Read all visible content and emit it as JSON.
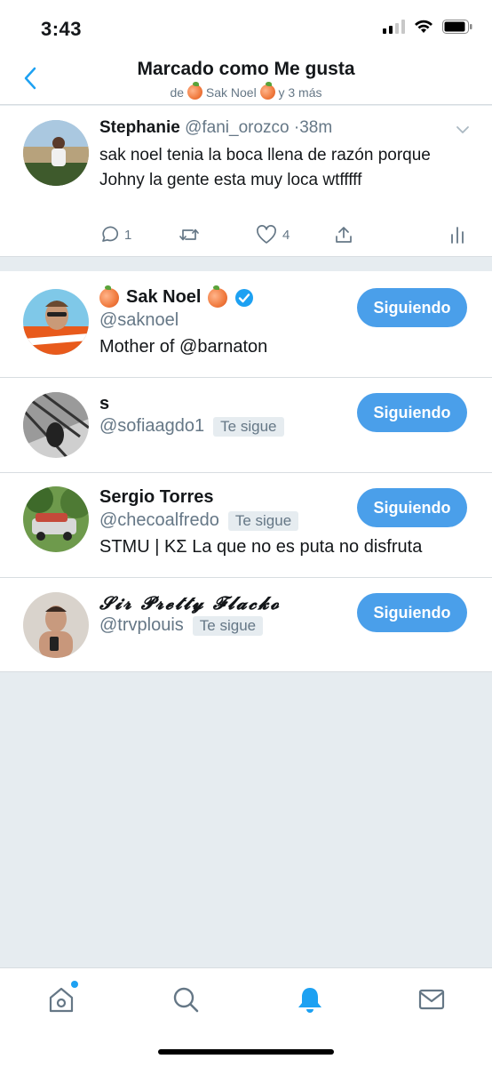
{
  "status_bar": {
    "time": "3:43"
  },
  "header": {
    "title": "Marcado como Me gusta",
    "sub_prefix": "de",
    "sub_name": "Sak Noel",
    "sub_suffix": "y 3 más"
  },
  "tweet": {
    "name": "Stephanie",
    "handle": "@fani_orozco",
    "time": "38m",
    "text": "sak noel tenia la boca llena de razón porque Johny la gente esta muy loca wtfffff",
    "reply_count": "1",
    "like_count": "4"
  },
  "users": [
    {
      "name": "Sak Noel",
      "handle": "@saknoel",
      "bio": "Mother of @barnaton",
      "follow_label": "Siguiendo",
      "verified": true
    },
    {
      "name": "s",
      "handle": "@sofiaagdo1",
      "badge": "Te sigue",
      "follow_label": "Siguiendo"
    },
    {
      "name": "Sergio Torres",
      "handle": "@checoalfredo",
      "badge": "Te sigue",
      "bio": "STMU | ΚΣ La que no es puta no disfruta",
      "follow_label": "Siguiendo"
    },
    {
      "name": "𝓢𝓲𝓻 𝓟𝓻𝓮𝓽𝓽𝔂 𝓕𝓵𝓪𝓬𝓴𝓸",
      "handle": "@trvplouis",
      "badge": "Te sigue",
      "follow_label": "Siguiendo"
    }
  ],
  "colors": {
    "accent": "#1da1f2",
    "button": "#4a9fea",
    "muted": "#657786",
    "background": "#e6ecf0"
  },
  "icons": [
    "back-chevron-icon",
    "chevron-down-icon",
    "reply-icon",
    "retweet-icon",
    "like-icon",
    "share-icon",
    "analytics-icon",
    "home-icon",
    "search-icon",
    "notifications-icon",
    "messages-icon",
    "verified-icon",
    "peach-emoji-icon"
  ]
}
